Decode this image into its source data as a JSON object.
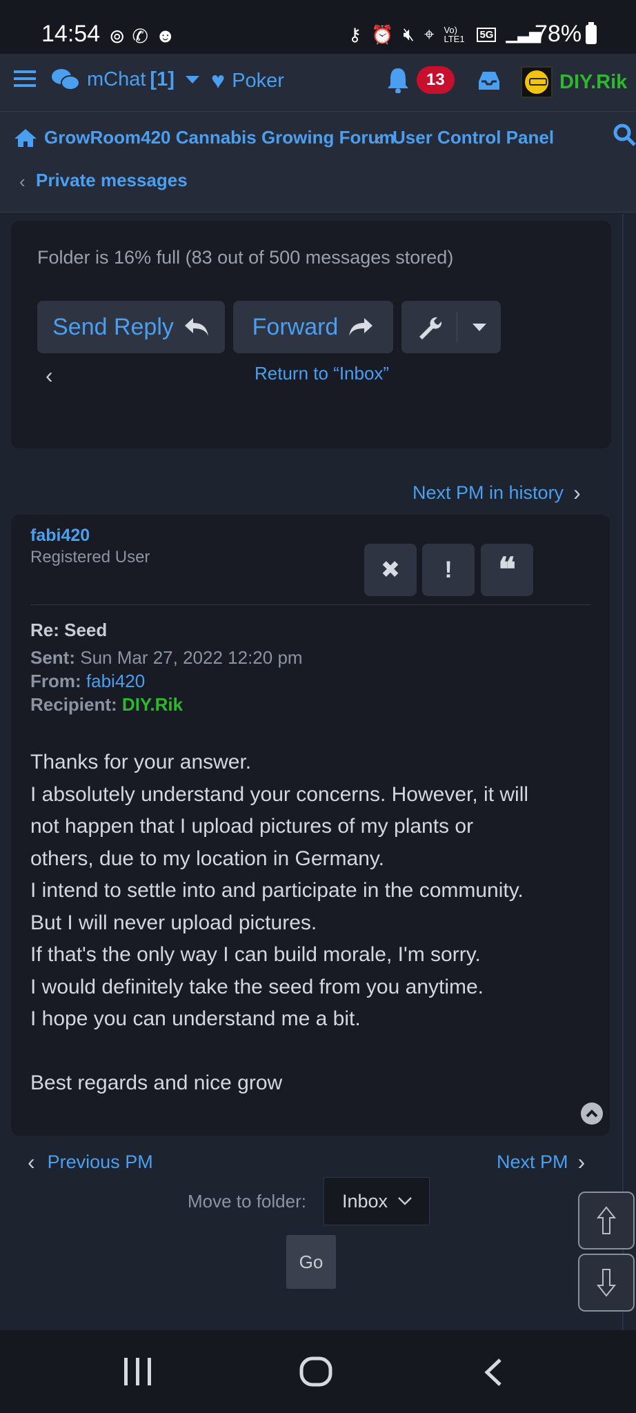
{
  "status_bar": {
    "time": "14:54",
    "signal_label": "Vo) LTE1",
    "network": "5G",
    "battery": "78%"
  },
  "top_nav": {
    "mchat_label": "mChat",
    "mchat_count": "[1]",
    "poker_label": "Poker",
    "notifications_count": "13",
    "username": "DIY.Rik"
  },
  "breadcrumbs": {
    "forum": "GrowRoom420 Cannabis Growing Forum",
    "ucp": "User Control Panel",
    "pm": "Private messages"
  },
  "folder_panel": {
    "status_text": "Folder is 16% full (83 out of 500 messages stored)",
    "send_reply_label": "Send Reply",
    "forward_label": "Forward",
    "return_link": "Return to “Inbox”"
  },
  "history_link": "Next PM in history",
  "message": {
    "author": "fabi420",
    "author_rank": "Registered User",
    "subject": "Re: Seed",
    "sent_label": "Sent:",
    "sent_value": "Sun Mar 27, 2022 12:20 pm",
    "from_label": "From:",
    "from_value": "fabi420",
    "recipient_label": "Recipient:",
    "recipient_value": "DIY.Rik",
    "body_lines": [
      "Thanks for your answer.",
      "I absolutely understand your concerns. However, it will",
      "not happen that I upload pictures of my plants or",
      "others, due to my location in Germany.",
      "I intend to settle into and participate in the community.",
      "But I will never upload pictures.",
      "If that's the only way I can build morale, I'm sorry.",
      "I would definitely take the seed from you anytime.",
      "I hope you can understand me a bit.",
      "",
      "Best regards and nice grow"
    ]
  },
  "pagination": {
    "previous_label": "Previous PM",
    "next_label": "Next PM"
  },
  "move_folder": {
    "label": "Move to folder:",
    "selected": "Inbox",
    "go_label": "Go"
  },
  "colors": {
    "accent": "#4a9ff0",
    "green_user": "#2db82d",
    "badge_red": "#c8102e",
    "background": "#1e2330",
    "panel": "#181b24"
  }
}
